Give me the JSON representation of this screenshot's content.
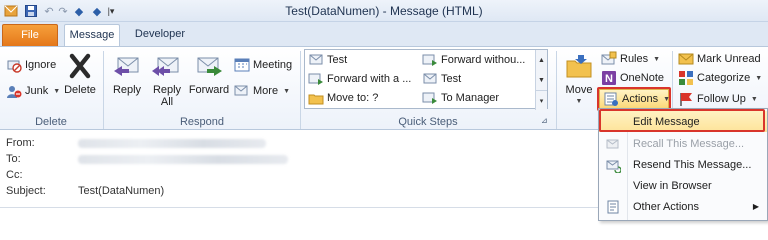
{
  "window": {
    "title": "Test(DataNumen)  -  Message (HTML)",
    "qat_icons": [
      "save-icon",
      "undo-icon",
      "redo-icon",
      "up-icon",
      "down-icon",
      "customize-icon"
    ]
  },
  "tabs": [
    {
      "label": "File"
    },
    {
      "label": "Message"
    },
    {
      "label": "Developer"
    }
  ],
  "groups": {
    "delete": {
      "label": "Delete",
      "ignore": "Ignore",
      "junk": "Junk",
      "delete": "Delete"
    },
    "respond": {
      "label": "Respond",
      "reply": "Reply",
      "reply_all_1": "Reply",
      "reply_all_2": "All",
      "forward": "Forward",
      "meeting": "Meeting",
      "more": "More"
    },
    "quick_steps": {
      "label": "Quick Steps",
      "items": [
        "Test",
        "Forward withou...",
        "Forward with a ...",
        "Test",
        "Move to: ?",
        "To Manager"
      ]
    },
    "move": {
      "move": "Move",
      "rules": "Rules",
      "onenote": "OneNote",
      "actions": "Actions"
    },
    "tags": {
      "mark_unread": "Mark Unread",
      "categorize": "Categorize",
      "follow_up": "Follow Up"
    }
  },
  "header": {
    "from_label": "From:",
    "to_label": "To:",
    "cc_label": "Cc:",
    "subject_label": "Subject:",
    "subject": "Test(DataNumen)"
  },
  "actions_menu": {
    "items": [
      {
        "label": "Edit Message",
        "enabled": true,
        "highlighted": true
      },
      {
        "label": "Recall This Message...",
        "enabled": false
      },
      {
        "label": "Resend This Message...",
        "enabled": true
      },
      {
        "label": "View in Browser",
        "enabled": true
      },
      {
        "label": "Other Actions",
        "enabled": true,
        "submenu": true
      }
    ]
  },
  "colors": {
    "file_tab": "#e4771a",
    "highlight_border": "#d9352b",
    "menu_highlight": "#fde9a8"
  }
}
